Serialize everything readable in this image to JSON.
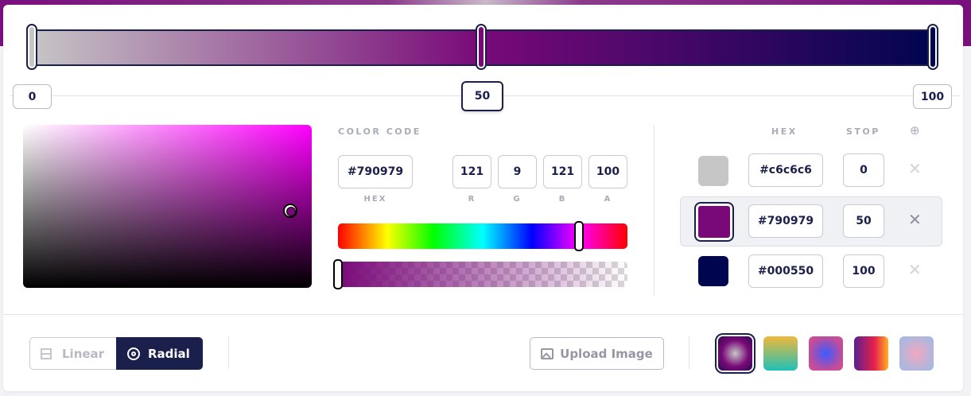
{
  "gradient": {
    "stop_labels": [
      "0",
      "50",
      "100"
    ],
    "colors": {
      "start": "#c6c6c6",
      "mid": "#790979",
      "end": "#000550"
    }
  },
  "picker": {
    "color_code_label": "COLOR CODE",
    "hex_value": "#790979",
    "r": "121",
    "g": "9",
    "b": "121",
    "a": "100",
    "hex_label": "HEX",
    "r_label": "R",
    "g_label": "G",
    "b_label": "B",
    "a_label": "A"
  },
  "stops_table": {
    "hex_header": "HEX",
    "stop_header": "STOP",
    "add_icon": "⊕",
    "rows": [
      {
        "hex": "#c6c6c6",
        "stop": "0",
        "color": "#c6c6c6"
      },
      {
        "hex": "#790979",
        "stop": "50",
        "color": "#790979"
      },
      {
        "hex": "#000550",
        "stop": "100",
        "color": "#000550"
      }
    ],
    "remove_icon": "✕"
  },
  "bottom": {
    "linear_label": "Linear",
    "radial_label": "Radial",
    "upload_label": "Upload Image"
  }
}
